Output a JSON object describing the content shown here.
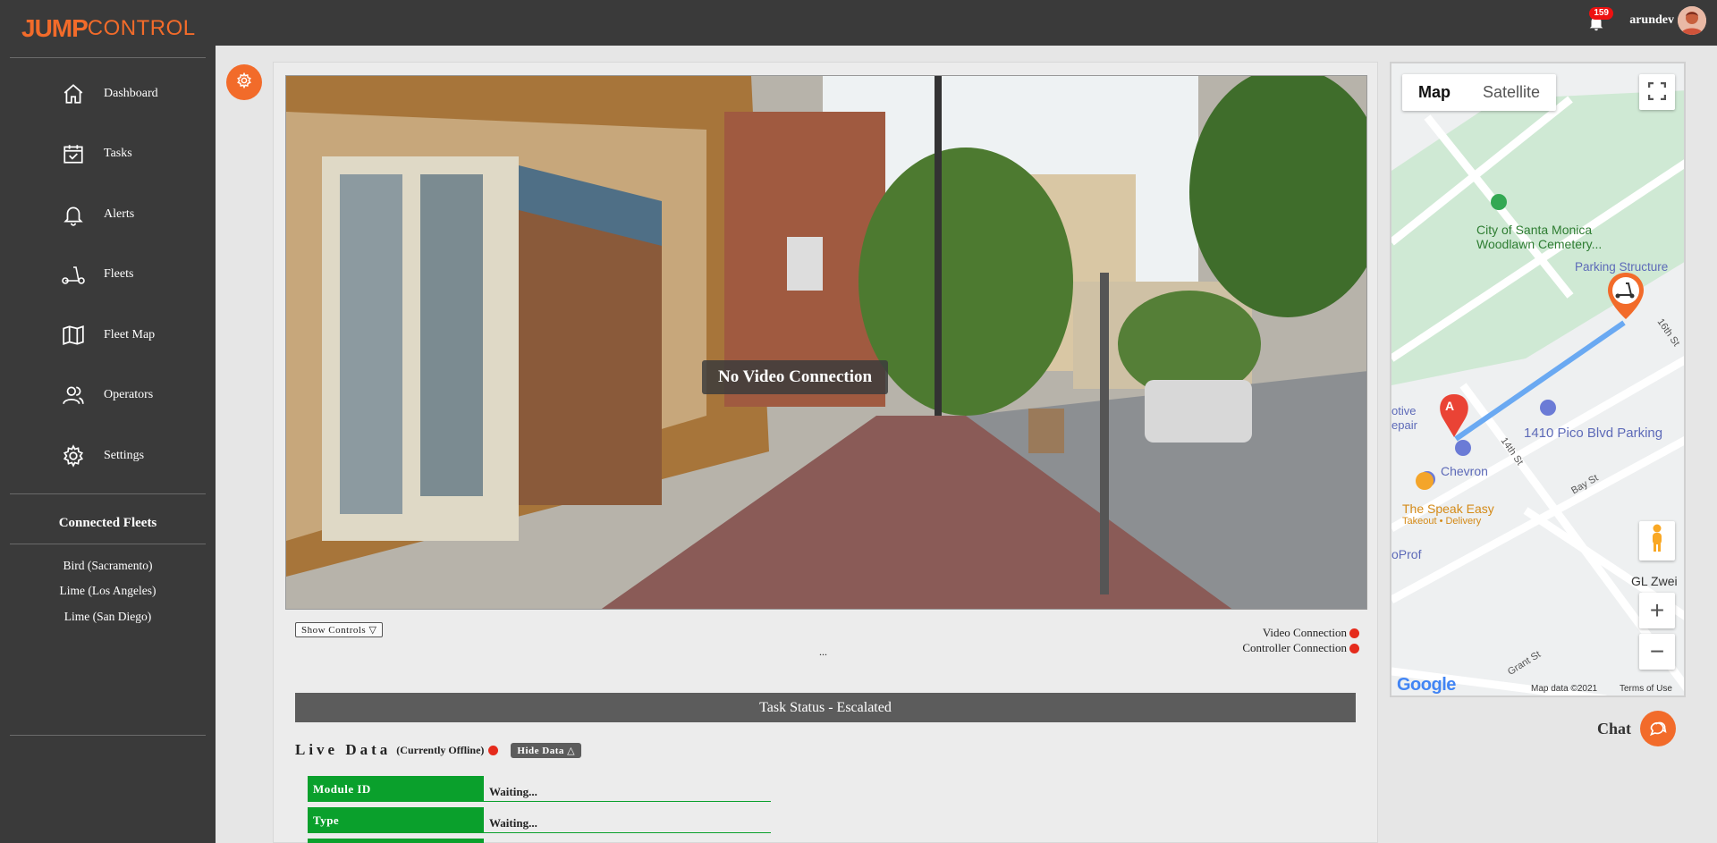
{
  "brand": {
    "part1": "JUMP",
    "part2": "CONTROL",
    "color": "#f26b2a"
  },
  "nav": [
    {
      "label": "Dashboard",
      "icon": "home-icon"
    },
    {
      "label": "Tasks",
      "icon": "calendar-check-icon"
    },
    {
      "label": "Alerts",
      "icon": "bell-icon"
    },
    {
      "label": "Fleets",
      "icon": "scooter-icon"
    },
    {
      "label": "Fleet Map",
      "icon": "map-icon"
    },
    {
      "label": "Operators",
      "icon": "users-icon"
    },
    {
      "label": "Settings",
      "icon": "gear-icon"
    }
  ],
  "connected_fleets": {
    "title": "Connected Fleets",
    "items": [
      "Bird (Sacramento)",
      "Lime (Los Angeles)",
      "Lime (San Diego)"
    ]
  },
  "topbar": {
    "notification_count": "159",
    "username": "arundev"
  },
  "video": {
    "message": "No Video Connection"
  },
  "controls": {
    "show_controls": "Show Controls ▽",
    "video_connection": "Video Connection",
    "controller_connection": "Controller Connection",
    "ellipsis": "..."
  },
  "task_status": "Task Status - Escalated",
  "live_data": {
    "title": "Live Data",
    "status": "(Currently Offline)",
    "hide_button": "Hide Data △",
    "rows": [
      {
        "key": "Module ID",
        "value": "Waiting..."
      },
      {
        "key": "Type",
        "value": "Waiting..."
      }
    ]
  },
  "map": {
    "tab_map": "Map",
    "tab_satellite": "Satellite",
    "labels": {
      "cemetery": "City of Santa Monica Woodlawn Cemetery...",
      "parking_structure": "Parking Structure",
      "pico_parking": "1410 Pico Blvd Parking",
      "chevron": "Chevron",
      "speak_easy": "The Speak Easy",
      "speak_easy_sub": "Takeout • Delivery",
      "st16": "16th St",
      "st14": "14th St",
      "bay_st": "Bay St",
      "grant_st": "Grant St",
      "optive": "otive",
      "repair": "epair",
      "prof": "oProf",
      "gl_zwei": "GL Zwei"
    },
    "marker_a": "A",
    "google": "Google",
    "map_data": "Map data ©2021",
    "terms": "Terms of Use"
  },
  "chat": {
    "label": "Chat"
  }
}
